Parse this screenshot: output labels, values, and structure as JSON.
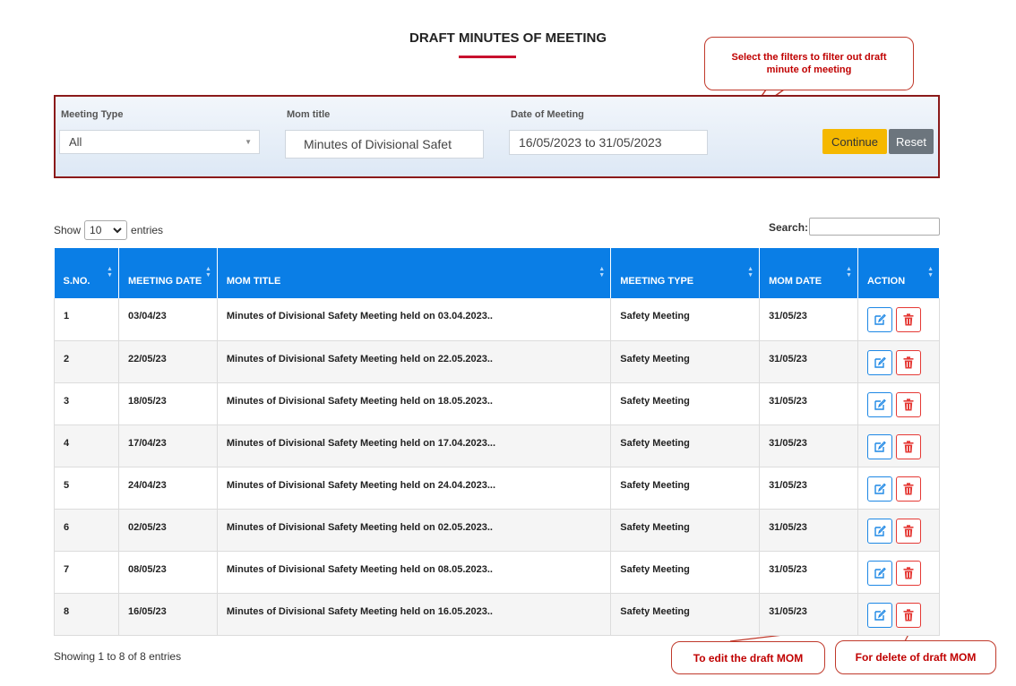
{
  "page": {
    "title": "DRAFT MINUTES OF MEETING"
  },
  "callouts": {
    "filters": "Select the filters to filter out draft minute of meeting",
    "edit": "To edit the draft MOM",
    "delete": "For delete of draft MOM"
  },
  "filters": {
    "meeting_type": {
      "label": "Meeting Type",
      "value": "All"
    },
    "mom_title": {
      "label": "Mom title",
      "value": "Minutes of Divisional Safet"
    },
    "date_of_meeting": {
      "label": "Date of Meeting",
      "value": "16/05/2023 to 31/05/2023"
    },
    "continue_label": "Continue",
    "reset_label": "Reset"
  },
  "table_controls": {
    "show_label": "Show",
    "length_value": "10",
    "entries_label": "entries",
    "search_label": "Search:"
  },
  "table": {
    "headers": [
      "S.NO.",
      "MEETING DATE",
      "MOM TITLE",
      "MEETING TYPE",
      "MOM DATE",
      "ACTION"
    ],
    "rows": [
      {
        "sno": "1",
        "meeting_date": "03/04/23",
        "title": "Minutes of Divisional Safety Meeting held on 03.04.2023..",
        "type": "Safety Meeting",
        "mom_date": "31/05/23"
      },
      {
        "sno": "2",
        "meeting_date": "22/05/23",
        "title": "Minutes of Divisional Safety Meeting held on 22.05.2023..",
        "type": "Safety Meeting",
        "mom_date": "31/05/23"
      },
      {
        "sno": "3",
        "meeting_date": "18/05/23",
        "title": "Minutes of Divisional Safety Meeting held on 18.05.2023..",
        "type": "Safety Meeting",
        "mom_date": "31/05/23"
      },
      {
        "sno": "4",
        "meeting_date": "17/04/23",
        "title": "Minutes of Divisional Safety Meeting held on 17.04.2023...",
        "type": "Safety Meeting",
        "mom_date": "31/05/23"
      },
      {
        "sno": "5",
        "meeting_date": "24/04/23",
        "title": "Minutes of Divisional Safety Meeting held on 24.04.2023...",
        "type": "Safety Meeting",
        "mom_date": "31/05/23"
      },
      {
        "sno": "6",
        "meeting_date": "02/05/23",
        "title": "Minutes of Divisional Safety Meeting held on 02.05.2023..",
        "type": "Safety Meeting",
        "mom_date": "31/05/23"
      },
      {
        "sno": "7",
        "meeting_date": "08/05/23",
        "title": "Minutes of Divisional Safety Meeting held on 08.05.2023..",
        "type": "Safety Meeting",
        "mom_date": "31/05/23"
      },
      {
        "sno": "8",
        "meeting_date": "16/05/23",
        "title": "Minutes of Divisional Safety Meeting held on 16.05.2023..",
        "type": "Safety Meeting",
        "mom_date": "31/05/23"
      }
    ]
  },
  "footer": {
    "info": "Showing 1 to 8 of 8 entries"
  },
  "icons": {
    "edit": "edit-icon",
    "delete": "trash-icon"
  },
  "colors": {
    "header_blue": "#0a7ee6",
    "accent_red": "#c8102e",
    "continue_yellow": "#f5b800",
    "reset_gray": "#6c757d",
    "callout_red": "#c00000"
  }
}
